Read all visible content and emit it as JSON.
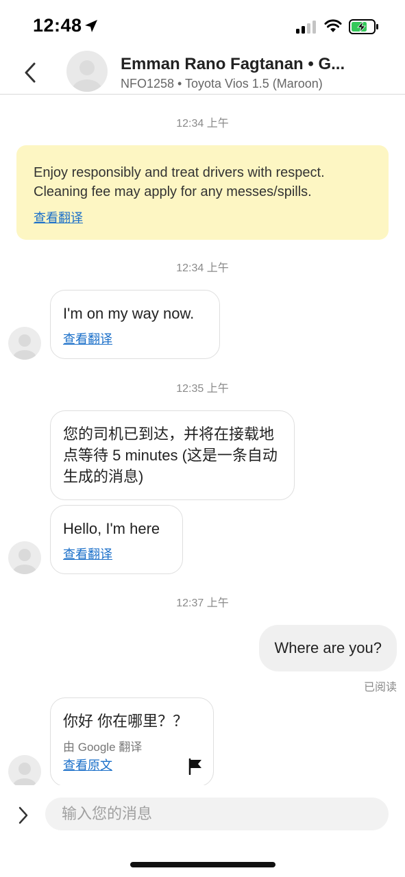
{
  "status_bar": {
    "time": "12:48"
  },
  "header": {
    "driver_name": "Emman Rano Fagtanan • G...",
    "vehicle_info": "NFO1258 • Toyota Vios 1.5 (Maroon)"
  },
  "messages": {
    "ts1": "12:34 上午",
    "notice_text": "Enjoy responsibly and treat drivers with respect. Cleaning fee may apply for any messes/spills.",
    "notice_link": "查看翻译",
    "ts2": "12:34 上午",
    "msg1_text": "I'm on my way now.",
    "msg1_link": "查看翻译",
    "ts3": "12:35 上午",
    "msg2_text": "您的司机已到达，并将在接载地点等待 5 minutes (这是一条自动生成的消息)",
    "msg3_text": "Hello, I'm here",
    "msg3_link": "查看翻译",
    "ts4": "12:37 上午",
    "msg4_text": "Where are you?",
    "msg4_status": "已阅读",
    "msg5_text": "你好 你在哪里？？",
    "msg5_translated_by": "由 Google 翻译",
    "msg5_link": "查看原文"
  },
  "input": {
    "placeholder": "输入您的消息"
  },
  "icons": {
    "back": "chevron-left-icon",
    "expand": "chevron-right-icon",
    "flag": "flag-icon",
    "location": "location-arrow-icon",
    "signal": "cellular-signal-icon",
    "wifi": "wifi-icon",
    "battery": "battery-charging-icon"
  },
  "colors": {
    "notice_bg": "#fdf6c3",
    "link": "#1a6fc9",
    "outgoing_bubble": "#f0f0f0",
    "battery_green": "#34c759"
  }
}
